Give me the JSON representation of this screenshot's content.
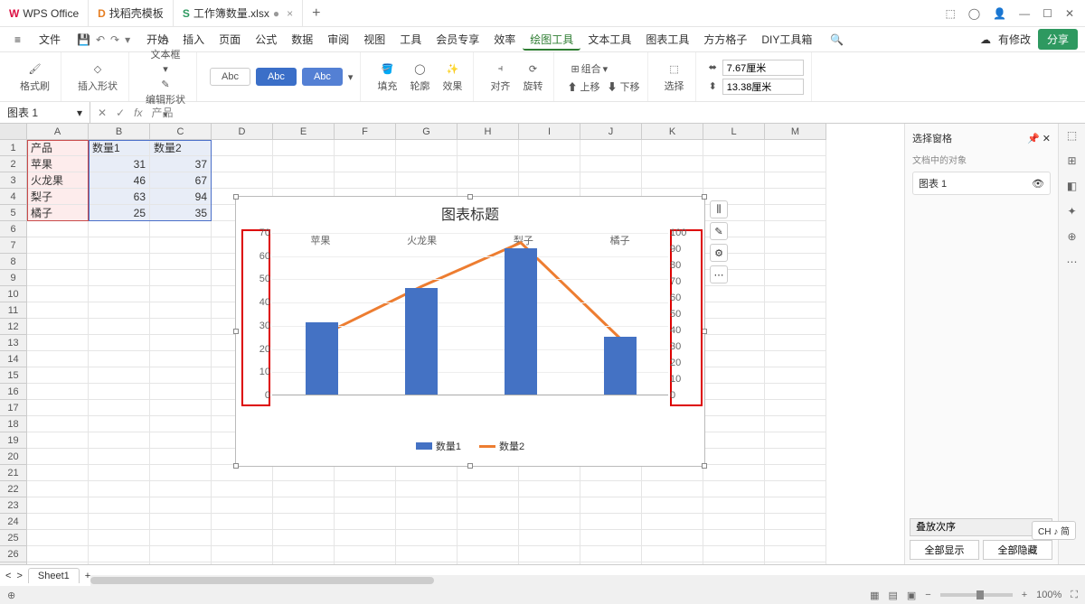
{
  "titlebar": {
    "tabs": [
      {
        "icon": "W",
        "icon_color": "#d14",
        "label": "WPS Office"
      },
      {
        "icon": "D",
        "icon_color": "#e67e22",
        "label": "找稻壳模板"
      },
      {
        "icon": "S",
        "icon_color": "#2e9960",
        "label": "工作簿数量.xlsx",
        "active": true,
        "dirty": "●"
      }
    ],
    "add": "+"
  },
  "menubar": {
    "file_icon": "≡",
    "file_label": "文件",
    "items": [
      "开始",
      "插入",
      "页面",
      "公式",
      "数据",
      "审阅",
      "视图",
      "工具",
      "会员专享",
      "效率",
      "绘图工具",
      "文本工具",
      "图表工具",
      "方方格子",
      "DIY工具箱"
    ],
    "active_index": 10,
    "search_icon": "🔍",
    "modified": "有修改",
    "share": "分享"
  },
  "ribbon": {
    "format_painter": "格式刷",
    "insert_shape": "插入形状",
    "text_box": "文本框",
    "edit_shape": "编辑形状",
    "style_label": "Abc",
    "fill": "填充",
    "outline": "轮廓",
    "effects": "效果",
    "align": "对齐",
    "rotate": "旋转",
    "group": "组合",
    "up": "上移",
    "down": "下移",
    "select": "选择",
    "width_icon": "⬌",
    "width": "7.67厘米",
    "height_icon": "⬍",
    "height": "13.38厘米"
  },
  "formula_bar": {
    "name": "图表 1",
    "fx": "fx",
    "content": "产品"
  },
  "grid": {
    "cols": [
      "A",
      "B",
      "C",
      "D",
      "E",
      "F",
      "G",
      "H",
      "I",
      "J",
      "K",
      "L",
      "M"
    ],
    "rows": 27,
    "data": [
      [
        "产品",
        "数量1",
        "数量2"
      ],
      [
        "苹果",
        "31",
        "37"
      ],
      [
        "火龙果",
        "46",
        "67"
      ],
      [
        "梨子",
        "63",
        "94"
      ],
      [
        "橘子",
        "25",
        "35"
      ]
    ]
  },
  "chart_data": {
    "type": "bar",
    "title": "图表标题",
    "categories": [
      "苹果",
      "火龙果",
      "梨子",
      "橘子"
    ],
    "series": [
      {
        "name": "数量1",
        "type": "bar",
        "values": [
          31,
          46,
          63,
          25
        ],
        "axis": "left",
        "color": "#4472c4"
      },
      {
        "name": "数量2",
        "type": "line",
        "values": [
          37,
          67,
          94,
          35
        ],
        "axis": "right",
        "color": "#ed7d31"
      }
    ],
    "y_left": {
      "min": 0,
      "max": 70,
      "step": 10,
      "ticks": [
        0,
        10,
        20,
        30,
        40,
        50,
        60,
        70
      ]
    },
    "y_right": {
      "min": 0,
      "max": 100,
      "step": 10,
      "ticks": [
        0,
        10,
        20,
        30,
        40,
        50,
        60,
        70,
        80,
        90,
        100
      ]
    }
  },
  "chart_side": {
    "b1": "⫼",
    "b2": "✎",
    "b3": "⚙",
    "b4": "⋯"
  },
  "selection_pane": {
    "title": "选择窗格",
    "sub": "文档中的对象",
    "item": "图表 1",
    "eye": "👁",
    "order": "叠放次序",
    "show_all": "全部显示",
    "hide_all": "全部隐藏"
  },
  "sheet_tabs": {
    "prev": "<",
    "next": ">",
    "sheet": "Sheet1",
    "add": "+"
  },
  "status": {
    "left": "⊕",
    "views": [
      "▦",
      "▤",
      "▣"
    ],
    "zoom": "100%"
  },
  "ime": "CH ♪ 简"
}
